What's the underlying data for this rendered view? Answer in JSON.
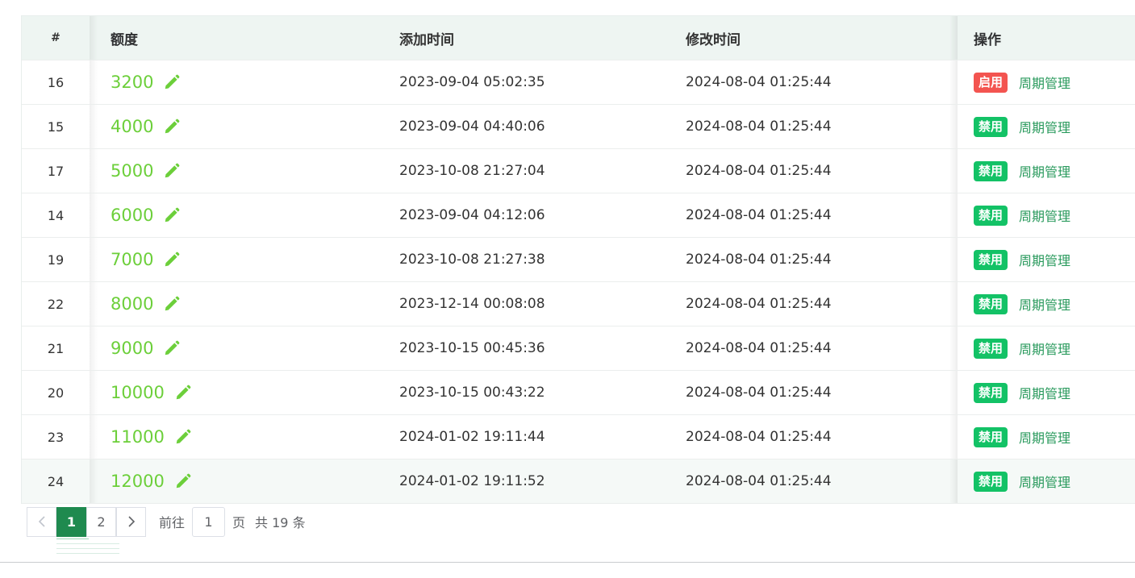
{
  "table": {
    "headers": {
      "id": "#",
      "amount": "额度",
      "added": "添加时间",
      "modified": "修改时间",
      "ops": "操作"
    },
    "rows": [
      {
        "id": "16",
        "amount": "3200",
        "added": "2023-09-04 05:02:35",
        "modified": "2024-08-04 01:25:44",
        "status": "启用",
        "status_color": "#f35450",
        "link": "周期管理"
      },
      {
        "id": "15",
        "amount": "4000",
        "added": "2023-09-04 04:40:06",
        "modified": "2024-08-04 01:25:44",
        "status": "禁用",
        "status_color": "#13c266",
        "link": "周期管理"
      },
      {
        "id": "17",
        "amount": "5000",
        "added": "2023-10-08 21:27:04",
        "modified": "2024-08-04 01:25:44",
        "status": "禁用",
        "status_color": "#13c266",
        "link": "周期管理"
      },
      {
        "id": "14",
        "amount": "6000",
        "added": "2023-09-04 04:12:06",
        "modified": "2024-08-04 01:25:44",
        "status": "禁用",
        "status_color": "#13c266",
        "link": "周期管理"
      },
      {
        "id": "19",
        "amount": "7000",
        "added": "2023-10-08 21:27:38",
        "modified": "2024-08-04 01:25:44",
        "status": "禁用",
        "status_color": "#13c266",
        "link": "周期管理"
      },
      {
        "id": "22",
        "amount": "8000",
        "added": "2023-12-14 00:08:08",
        "modified": "2024-08-04 01:25:44",
        "status": "禁用",
        "status_color": "#13c266",
        "link": "周期管理"
      },
      {
        "id": "21",
        "amount": "9000",
        "added": "2023-10-15 00:45:36",
        "modified": "2024-08-04 01:25:44",
        "status": "禁用",
        "status_color": "#13c266",
        "link": "周期管理"
      },
      {
        "id": "20",
        "amount": "10000",
        "added": "2023-10-15 00:43:22",
        "modified": "2024-08-04 01:25:44",
        "status": "禁用",
        "status_color": "#13c266",
        "link": "周期管理"
      },
      {
        "id": "23",
        "amount": "11000",
        "added": "2024-01-02 19:11:44",
        "modified": "2024-08-04 01:25:44",
        "status": "禁用",
        "status_color": "#13c266",
        "link": "周期管理"
      },
      {
        "id": "24",
        "amount": "12000",
        "added": "2024-01-02 19:11:52",
        "modified": "2024-08-04 01:25:44",
        "status": "禁用",
        "status_color": "#13c266",
        "link": "周期管理"
      }
    ]
  },
  "pagination": {
    "pages": [
      "1",
      "2"
    ],
    "current": "1",
    "goto_label": "前往",
    "goto_value": "1",
    "page_suffix": "页",
    "total_text": "共 19 条"
  },
  "colors": {
    "accent": "#1f8a4f",
    "amount": "#6ccf3a",
    "link": "#2a9a5d"
  }
}
